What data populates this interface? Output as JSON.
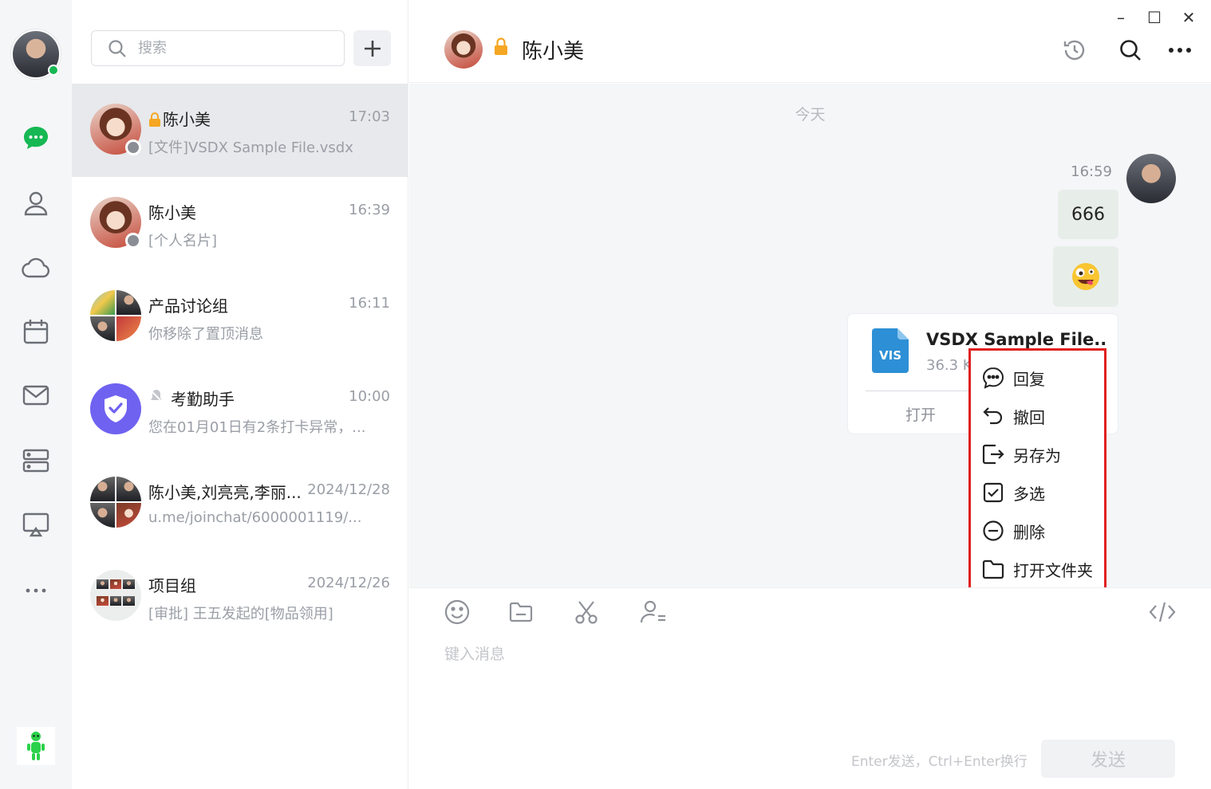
{
  "window": {
    "minimize": "–",
    "maximize": "☐",
    "close": "✕"
  },
  "search": {
    "placeholder": "搜索"
  },
  "conversations": [
    {
      "name": "陈小美",
      "time": "17:03",
      "preview": "[文件]VSDX Sample File.vsdx",
      "locked": true
    },
    {
      "name": "陈小美",
      "time": "16:39",
      "preview": "[个人名片]"
    },
    {
      "name": "产品讨论组",
      "time": "16:11",
      "preview": "你移除了置顶消息"
    },
    {
      "name": "考勤助手",
      "time": "10:00",
      "preview": "您在01月01日有2条打卡异常，..."
    },
    {
      "name": "陈小美,刘亮亮,李丽...",
      "time": "2024/12/28",
      "preview": "u.me/joinchat/6000001119/..."
    },
    {
      "name": "项目组",
      "time": "2024/12/26",
      "preview": "[审批] 王五发起的[物品领用]"
    }
  ],
  "chat": {
    "title": "陈小美",
    "date_divider": "今天",
    "message_time": "16:59",
    "text_message": "666",
    "emoji": "🤪",
    "file": {
      "name": "VSDX Sample File....",
      "size": "36.3 K",
      "icon_label": "VIS",
      "open_label": "打开"
    }
  },
  "context_menu": {
    "items": [
      "回复",
      "撤回",
      "另存为",
      "多选",
      "删除",
      "打开文件夹"
    ]
  },
  "composer": {
    "placeholder": "键入消息",
    "hint": "Enter发送，Ctrl+Enter换行",
    "send_label": "发送"
  },
  "colors": {
    "accent_green": "#16b853",
    "highlight_red": "#e02020",
    "file_blue": "#2d8fd5",
    "shield_purple": "#6f62f0"
  }
}
